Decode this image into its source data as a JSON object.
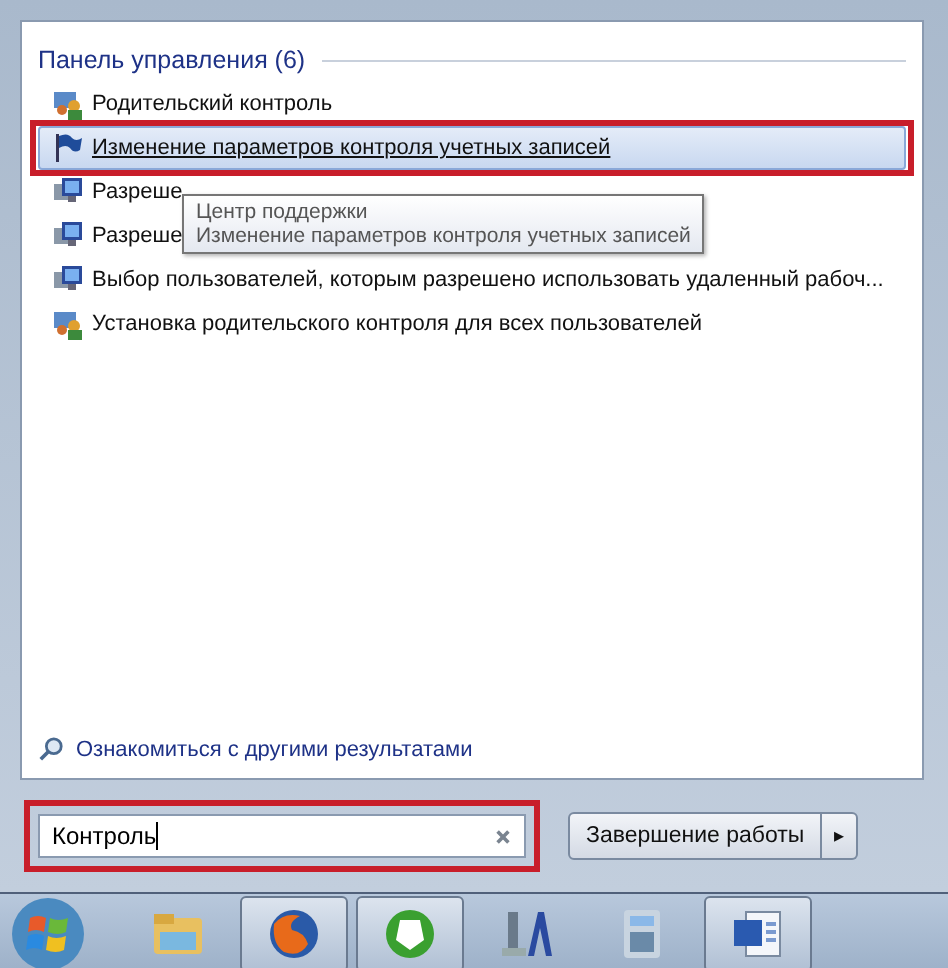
{
  "results": {
    "heading": "Панель управления (6)",
    "items": [
      {
        "label": "Родительский контроль",
        "kind": "people",
        "selected": false,
        "annotated": false
      },
      {
        "label": "Изменение параметров контроля учетных записей",
        "kind": "flag",
        "selected": true,
        "annotated": true
      },
      {
        "label": "Разреше",
        "kind": "monitor",
        "selected": false,
        "annotated": false
      },
      {
        "label": "Разреше",
        "kind": "monitor",
        "selected": false,
        "annotated": false
      },
      {
        "label": "Выбор пользователей, которым разрешено использовать удаленный рабоч...",
        "kind": "monitor",
        "selected": false,
        "annotated": false
      },
      {
        "label": "Установка родительского контроля для всех пользователей",
        "kind": "people",
        "selected": false,
        "annotated": false
      }
    ]
  },
  "tooltip": {
    "title": "Центр поддержки",
    "text": "Изменение параметров контроля учетных записей"
  },
  "more_results": "Ознакомиться с другими результатами",
  "search": {
    "value": "Контроль",
    "annotated": true
  },
  "shutdown": {
    "label": "Завершение работы",
    "arrow": "▸"
  },
  "taskbar": [
    {
      "kind": "folder",
      "running": false
    },
    {
      "kind": "globe",
      "running": true
    },
    {
      "kind": "green",
      "running": true
    },
    {
      "kind": "tool",
      "running": false
    },
    {
      "kind": "calculator",
      "running": false
    },
    {
      "kind": "document",
      "running": true
    }
  ]
}
